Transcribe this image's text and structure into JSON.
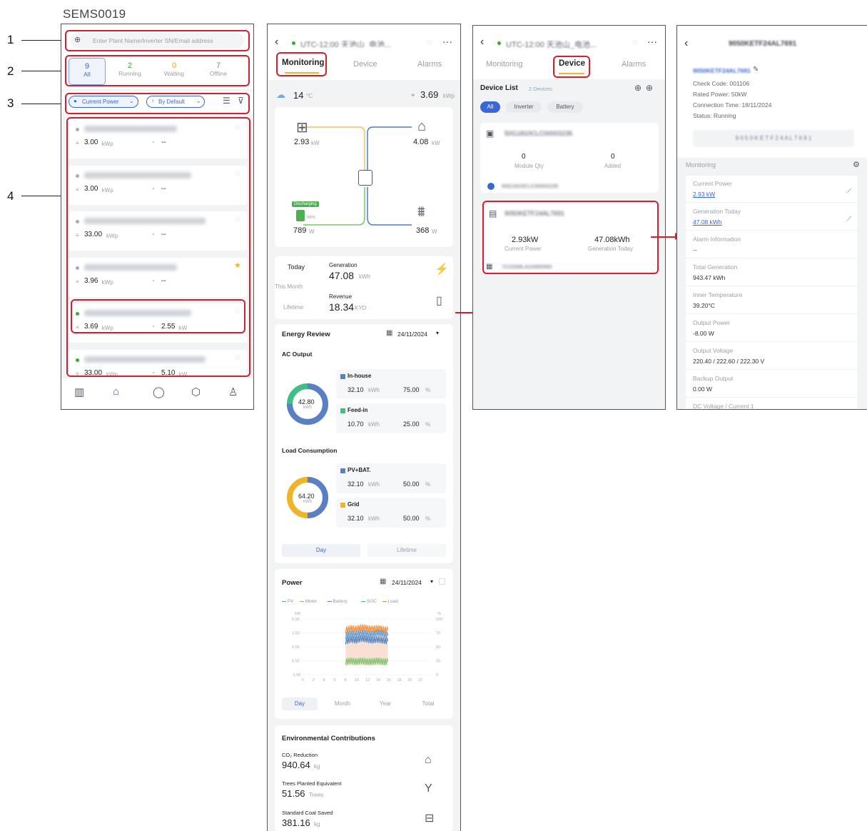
{
  "doc_title": "SEMS0019",
  "callouts": [
    "1",
    "2",
    "3",
    "4"
  ],
  "p1": {
    "search_placeholder": "Enter Plant Name/Inverter SN/Email address",
    "tabs": [
      {
        "count": "9",
        "label": "All"
      },
      {
        "count": "2",
        "label": "Running"
      },
      {
        "count": "0",
        "label": "Waiting"
      },
      {
        "count": "7",
        "label": "Offline"
      }
    ],
    "filter_power": "Current Power",
    "filter_sort": "By Default",
    "plants": [
      {
        "cap": "3.00",
        "cap_unit": "kWp",
        "pow": "--",
        "pow_unit": "",
        "active": false,
        "fav": false
      },
      {
        "cap": "3.00",
        "cap_unit": "kWp",
        "pow": "--",
        "pow_unit": "",
        "active": false,
        "fav": false
      },
      {
        "cap": "33.00",
        "cap_unit": "kWp",
        "pow": "--",
        "pow_unit": "",
        "active": false,
        "fav": false
      },
      {
        "cap": "3.96",
        "cap_unit": "kWp",
        "pow": "--",
        "pow_unit": "",
        "active": false,
        "fav": true
      },
      {
        "cap": "3.69",
        "cap_unit": "kWp",
        "pow": "2.55",
        "pow_unit": "kW",
        "active": true,
        "fav": false
      },
      {
        "cap": "33.00",
        "cap_unit": "kWp",
        "pow": "5.10",
        "pow_unit": "kW",
        "active": true,
        "fav": false
      }
    ],
    "nav_icons": [
      "stats-icon",
      "home-icon",
      "bell-icon",
      "box-icon",
      "user-icon"
    ]
  },
  "p2": {
    "title": "UTC-12:00 天池山_电池...",
    "tabs": [
      "Monitoring",
      "Device",
      "Alarms"
    ],
    "weather_temp": "14",
    "weather_unit": "°C",
    "capacity": "3.69",
    "capacity_unit": "kWp",
    "pv": "2.93",
    "pv_unit": "kW",
    "home": "4.08",
    "home_unit": "kW",
    "battery_status": "Discharging",
    "battery_soc": "66%",
    "battery": "789",
    "battery_unit": "W",
    "grid": "368",
    "grid_unit": "W",
    "periods": [
      "Today",
      "This Month",
      "Lifetime"
    ],
    "gen_label": "Generation",
    "gen_val": "47.08",
    "gen_unit": "kWh",
    "rev_label": "Revenue",
    "rev_val": "18.34",
    "rev_unit": "KYD",
    "er_title": "Energy Review",
    "er_date": "24/11/2024",
    "ac_title": "AC Output",
    "ac_total": "42.80",
    "ac_unit": "kWh",
    "ac_items": [
      {
        "name": "In-house",
        "val": "32.10",
        "unit": "kWh",
        "pct": "75.00",
        "pu": "%",
        "color": "#5b7fc7"
      },
      {
        "name": "Feed-in",
        "val": "10.70",
        "unit": "kWh",
        "pct": "25.00",
        "pu": "%",
        "color": "#3fbf86"
      }
    ],
    "lc_title": "Load Consumption",
    "lc_total": "64.20",
    "lc_unit": "kWh",
    "lc_items": [
      {
        "name": "PV+BAT.",
        "val": "32.10",
        "unit": "kWh",
        "pct": "50.00",
        "pu": "%",
        "color": "#5b7fc7"
      },
      {
        "name": "Grid",
        "val": "32.10",
        "unit": "kWh",
        "pct": "50.00",
        "pu": "%",
        "color": "#f0b429"
      }
    ],
    "er_toggle": [
      "Day",
      "Lifetime"
    ],
    "pw_title": "Power",
    "pw_date": "24/11/2024",
    "legend": [
      {
        "name": "PV",
        "color": "#5b9bd5"
      },
      {
        "name": "Meter",
        "color": "#7ac36a"
      },
      {
        "name": "Battery",
        "color": "#4a7fc1"
      },
      {
        "name": "SOC",
        "color": "#3fb8a0"
      },
      {
        "name": "Load",
        "color": "#f08c3a"
      }
    ],
    "pw_yunit_l": "kW",
    "pw_yunit_r": "%",
    "pw_yticks_l": [
      "5.00",
      "3.50",
      "2.00",
      "0.50",
      "-1.00"
    ],
    "pw_yticks_r": [
      "100",
      "75",
      "50",
      "25",
      "0"
    ],
    "pw_xticks": [
      "0",
      "2",
      "4",
      "6",
      "8",
      "10",
      "12",
      "14",
      "16",
      "18",
      "20",
      "22"
    ],
    "pw_toggle": [
      "Day",
      "Month",
      "Year",
      "Total"
    ],
    "env_title": "Environmental Contributions",
    "env": [
      {
        "label": "CO₂ Reduction",
        "val": "940.64",
        "unit": "kg"
      },
      {
        "label": "Trees Planted Equivalent",
        "val": "51.56",
        "unit": "Trees"
      },
      {
        "label": "Standard Coal Saved",
        "val": "381.16",
        "unit": "kg"
      }
    ]
  },
  "p3": {
    "title": "UTC-12:00 天池山_电池...",
    "tabs": [
      "Monitoring",
      "Device",
      "Alarms"
    ],
    "list_title": "Device List",
    "list_count": "2 Devices",
    "chips": [
      "All",
      "Inverter",
      "Battery"
    ],
    "dev1_sn": "50G1810CLC00003235",
    "dev1_stats": [
      {
        "val": "0",
        "label": "Module Qty"
      },
      {
        "val": "0",
        "label": "Added"
      }
    ],
    "dev1_sub": "50G1810CLC00003235",
    "dev2_sn": "9050KETF24AL7691",
    "dev2_stats": [
      {
        "val": "2.93kW",
        "label": "Current Power"
      },
      {
        "val": "47.08kWh",
        "label": "Generation Today"
      }
    ],
    "dev2_sub": "7210SMLA24900083"
  },
  "p4": {
    "title": "9050KETF24AL7691",
    "sn": "9050KETF24AL7691",
    "check_code": "Check Code: 001106",
    "rated_power": "Rated Power: 50kW",
    "conn_time": "Connection Time: 18/11/2024",
    "status": "Status: Running",
    "barcode": "9 0 5 0 K E T F 2 4 A L 7 6 9 1",
    "section": "Monitoring",
    "rows": [
      {
        "label": "Current Power",
        "val": "2.93 kW",
        "link": true,
        "chart": true
      },
      {
        "label": "Generation Today",
        "val": "47.08 kWh",
        "link": true,
        "chart": true
      },
      {
        "label": "Alarm Information",
        "val": "--",
        "link": false,
        "chart": false
      },
      {
        "label": "Total Generation",
        "val": "943.47 kWh",
        "link": false,
        "chart": false
      },
      {
        "label": "Inner Temperature",
        "val": "39.20°C",
        "link": false,
        "chart": false
      },
      {
        "label": "Output Power",
        "val": "-8.00 W",
        "link": false,
        "chart": false
      },
      {
        "label": "Output Voltage",
        "val": "220.40 / 222.60 / 222.30 V",
        "link": false,
        "chart": false
      },
      {
        "label": "Backup Output",
        "val": "0.00 W",
        "link": false,
        "chart": false
      },
      {
        "label": "DC Voltage / Current 1",
        "val": "",
        "link": false,
        "chart": false
      }
    ]
  },
  "chart_data": {
    "type": "line",
    "title": "Power",
    "x_range": [
      0,
      24
    ],
    "xlabel": "",
    "ylabel": "kW",
    "ylim": [
      -1,
      5
    ],
    "y2lim": [
      0,
      100
    ],
    "series": [
      {
        "name": "PV",
        "values": [
          [
            8,
            3.2
          ],
          [
            9,
            3.4
          ],
          [
            10,
            3.3
          ],
          [
            11,
            3.5
          ],
          [
            12,
            3.4
          ],
          [
            13,
            3.3
          ],
          [
            14,
            3.5
          ],
          [
            15,
            3.4
          ],
          [
            16,
            3.2
          ]
        ]
      },
      {
        "name": "Load",
        "values": [
          [
            8,
            3.8
          ],
          [
            9,
            4.0
          ],
          [
            10,
            3.9
          ],
          [
            11,
            4.1
          ],
          [
            12,
            4.0
          ],
          [
            13,
            3.9
          ],
          [
            14,
            4.0
          ],
          [
            15,
            3.9
          ],
          [
            16,
            3.8
          ]
        ]
      },
      {
        "name": "Battery",
        "values": [
          [
            8,
            2.6
          ],
          [
            9,
            2.8
          ],
          [
            10,
            2.7
          ],
          [
            11,
            2.9
          ],
          [
            12,
            2.8
          ],
          [
            13,
            2.7
          ],
          [
            14,
            2.8
          ],
          [
            15,
            2.7
          ],
          [
            16,
            2.6
          ]
        ]
      },
      {
        "name": "Meter",
        "values": [
          [
            8,
            0.4
          ],
          [
            9,
            0.5
          ],
          [
            10,
            0.4
          ],
          [
            11,
            0.5
          ],
          [
            12,
            0.4
          ],
          [
            13,
            0.4
          ],
          [
            14,
            0.5
          ],
          [
            15,
            0.4
          ],
          [
            16,
            0.4
          ]
        ]
      }
    ]
  }
}
